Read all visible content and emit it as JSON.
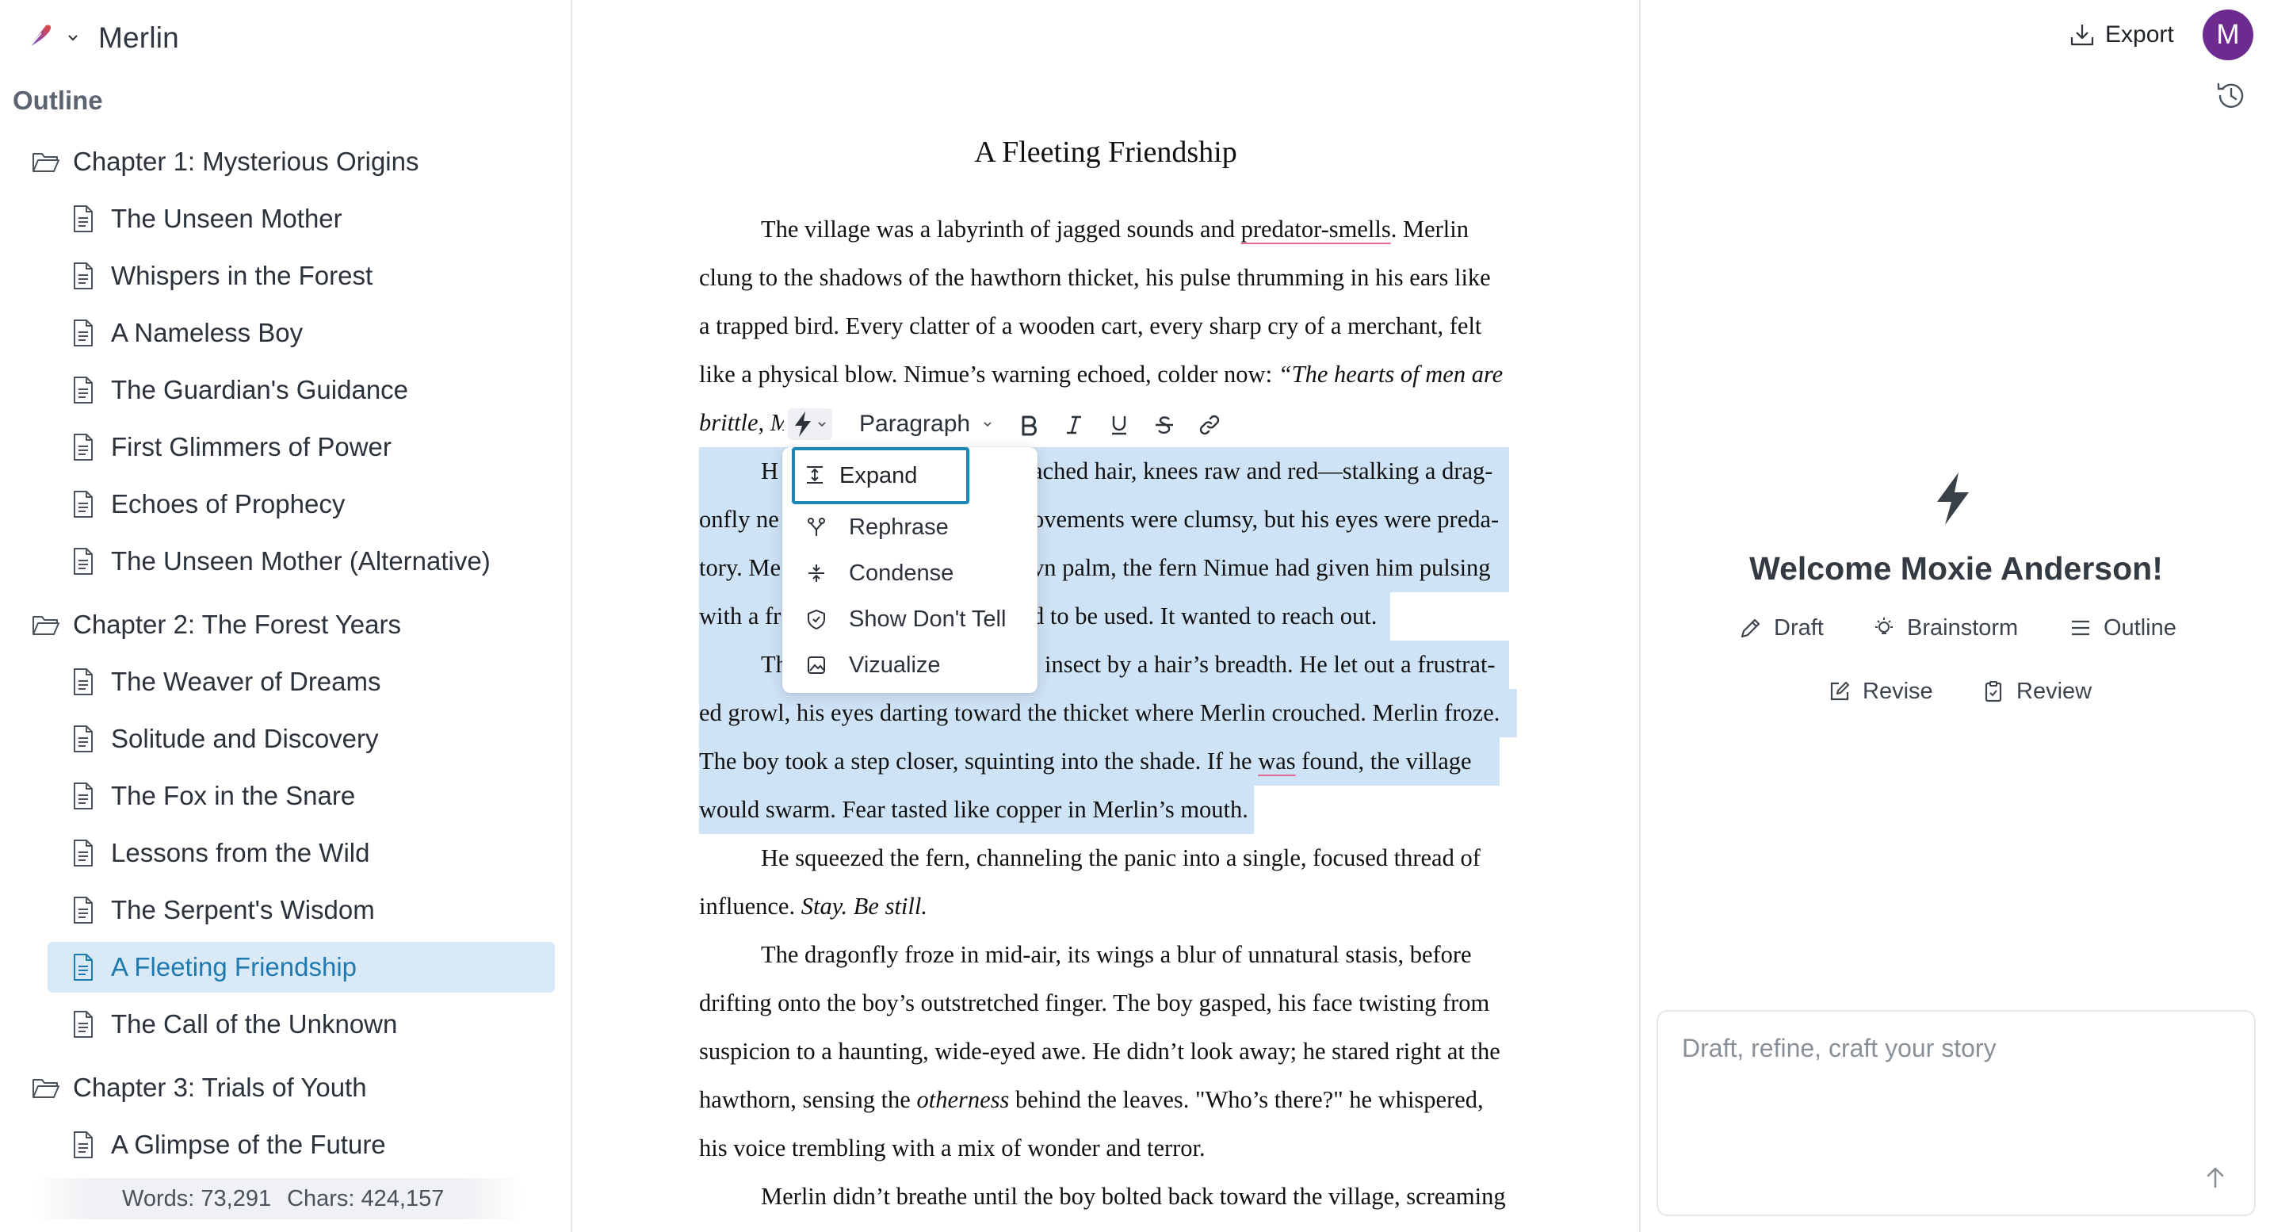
{
  "app": {
    "name": "Merlin"
  },
  "sidebar": {
    "heading": "Outline",
    "chapters": [
      {
        "title": "Chapter 1: Mysterious Origins",
        "scenes": [
          "The Unseen Mother",
          "Whispers in the Forest",
          "A Nameless Boy",
          "The Guardian's Guidance",
          "First Glimmers of Power",
          "Echoes of Prophecy",
          "The Unseen Mother (Alternative)"
        ]
      },
      {
        "title": "Chapter 2: The Forest Years",
        "scenes": [
          "The Weaver of Dreams",
          "Solitude and Discovery",
          "The Fox in the Snare",
          "Lessons from the Wild",
          "The Serpent's Wisdom",
          "A Fleeting Friendship",
          "The Call of the Unknown"
        ]
      },
      {
        "title": "Chapter 3: Trials of Youth",
        "scenes": [
          "A Glimpse of the Future"
        ]
      }
    ],
    "active_scene": "A Fleeting Friendship",
    "stats": {
      "words": "Words: 73,291",
      "chars": "Chars: 424,157"
    }
  },
  "editor": {
    "title": "A Fleeting Friendship",
    "toolbar": {
      "block_type": "Paragraph"
    },
    "ai_menu": {
      "items": [
        "Expand",
        "Rephrase",
        "Condense",
        "Show Don't Tell",
        "Vizualize"
      ],
      "focused": "Expand"
    },
    "lines": {
      "l1a": "The village was a labyrinth of jagged sounds and ",
      "l1b": "predator-smells",
      "l1c": ". Merlin",
      "l2": "clung to the shadows of the hawthorn thicket, his pulse thrumming in his ears like",
      "l3": "a trapped bird. Every clatter of a wooden cart, every sharp cry of a merchant, felt",
      "l4a": "like a physical blow. Nimue’s warning echoed, colder now: ",
      "l4b": "“The hearts of men are",
      "l5": "brittle, M",
      "l6a": "H",
      "l6b": "ached hair, knees raw and red—stalking a drag-",
      "l7a": "onfly ne",
      "l7b": "ovements were clumsy, but his eyes were preda-",
      "l8a": "tory. Me",
      "l8b": "vn palm, the fern Nimue had given him pulsing",
      "l9a": "with a fr",
      "l9b": "d to be used. It wanted to reach out.",
      "l10a": "Th",
      "l10b": "insect by a hair’s breadth. He let out a frustrat-",
      "l11": "ed growl, his eyes darting toward the thicket where Merlin crouched. Merlin froze.",
      "l12a": "The boy took a step closer, squinting into the shade. If he ",
      "l12b": "was",
      "l12c": " found, the village",
      "l13": "would swarm. Fear tasted like copper in Merlin’s mouth.",
      "l14": "He squeezed the fern, channeling the panic into a single, focused thread of",
      "l15a": "influence. ",
      "l15b": "Stay. Be still.",
      "l16": "The dragonfly froze in mid-air, its wings a blur of unnatural stasis, before",
      "l17": "drifting onto the boy’s outstretched finger. The boy gasped, his face twisting from",
      "l18": "suspicion to a haunting, wide-eyed awe. He didn’t look away; he stared right at the",
      "l19a": "hawthorn, sensing the ",
      "l19b": "otherness",
      "l19c": " behind the leaves. \"Who’s there?\" he whispered,",
      "l20": "his voice trembling with a mix of wonder and terror.",
      "l21": "Merlin didn’t breathe until the boy bolted back toward the village, screaming"
    }
  },
  "right_panel": {
    "export_label": "Export",
    "avatar_initial": "M",
    "welcome": "Welcome Moxie Anderson!",
    "modes": [
      "Draft",
      "Brainstorm",
      "Outline",
      "Revise",
      "Review"
    ],
    "prompt_placeholder": "Draft, refine, craft your story"
  },
  "colors": {
    "accent": "#1e86b5",
    "selection": "#cfe3f6",
    "active_item": "#d9e9f5",
    "avatar": "#6f2a8f",
    "spellcheck": "#e46b8f"
  }
}
